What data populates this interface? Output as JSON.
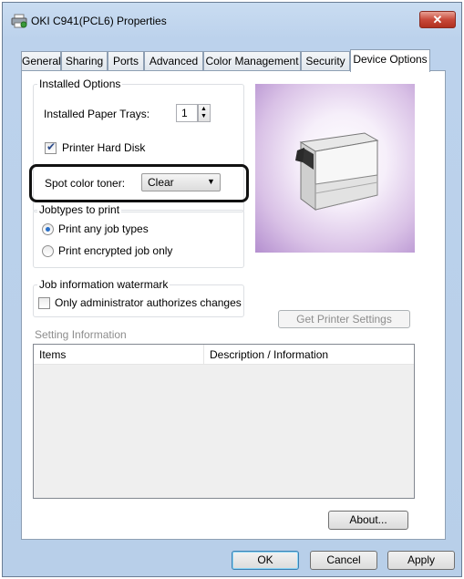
{
  "window": {
    "title": "OKI C941(PCL6) Properties",
    "icon": "printer-icon",
    "close_glyph": "✕"
  },
  "tabs": [
    {
      "label": "General",
      "active": false
    },
    {
      "label": "Sharing",
      "active": false
    },
    {
      "label": "Ports",
      "active": false
    },
    {
      "label": "Advanced",
      "active": false
    },
    {
      "label": "Color Management",
      "active": false
    },
    {
      "label": "Security",
      "active": false
    },
    {
      "label": "Device Options",
      "active": true
    }
  ],
  "installed_options": {
    "legend": "Installed Options",
    "paper_trays_label": "Installed Paper Trays:",
    "paper_trays_value": "1",
    "hard_disk_label": "Printer Hard Disk",
    "hard_disk_checked": true,
    "spot_color_label": "Spot color toner:",
    "spot_color_value": "Clear"
  },
  "jobtypes": {
    "legend": "Jobtypes to print",
    "options": [
      "Print any job types",
      "Print encrypted job only"
    ],
    "selected": 0
  },
  "watermark": {
    "legend": "Job information watermark",
    "checkbox_label": "Only administrator authorizes changes",
    "checked": false
  },
  "get_printer_settings_label": "Get Printer Settings",
  "setting_info": {
    "heading": "Setting Information",
    "columns": [
      "Items",
      "Description / Information"
    ]
  },
  "about_label": "About...",
  "footer": {
    "ok": "OK",
    "cancel": "Cancel",
    "apply": "Apply"
  },
  "colors": {
    "titlebar": "#bcd2ec",
    "close_button": "#c8493a",
    "printer_backdrop": "#b48fcf"
  }
}
